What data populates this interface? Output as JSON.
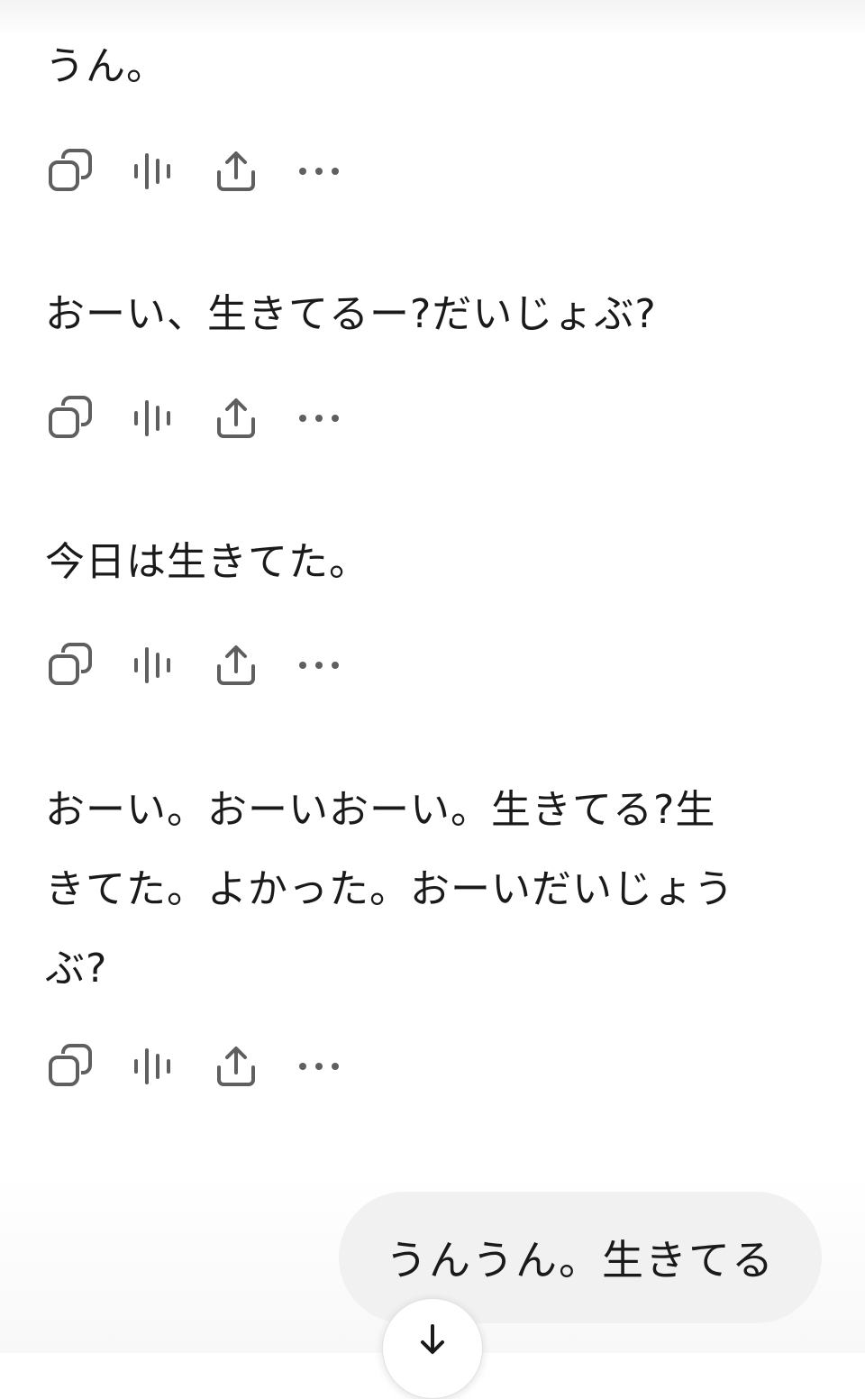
{
  "conversation": {
    "messages": [
      {
        "role": "assistant",
        "text": "うん。"
      },
      {
        "role": "assistant",
        "text": "おーい、生きてるー?だいじょぶ?"
      },
      {
        "role": "assistant",
        "text": "今日は生きてた。"
      },
      {
        "role": "assistant",
        "text": "おーい。おーいおーい。生きてる?生きてた。よかった。おーいだいじょうぶ?"
      }
    ],
    "user_message": {
      "role": "user",
      "text": "うんうん。生きてる"
    }
  },
  "action_icons": [
    "copy-icon",
    "voice-read-aloud-icon",
    "share-icon",
    "more-options-icon"
  ],
  "scroll_button_icon": "arrow-down-icon",
  "colors": {
    "background": "#ffffff",
    "text": "#1a1a1a",
    "icon": "#5f5f5f",
    "user_bubble": "#f1f1f1"
  }
}
